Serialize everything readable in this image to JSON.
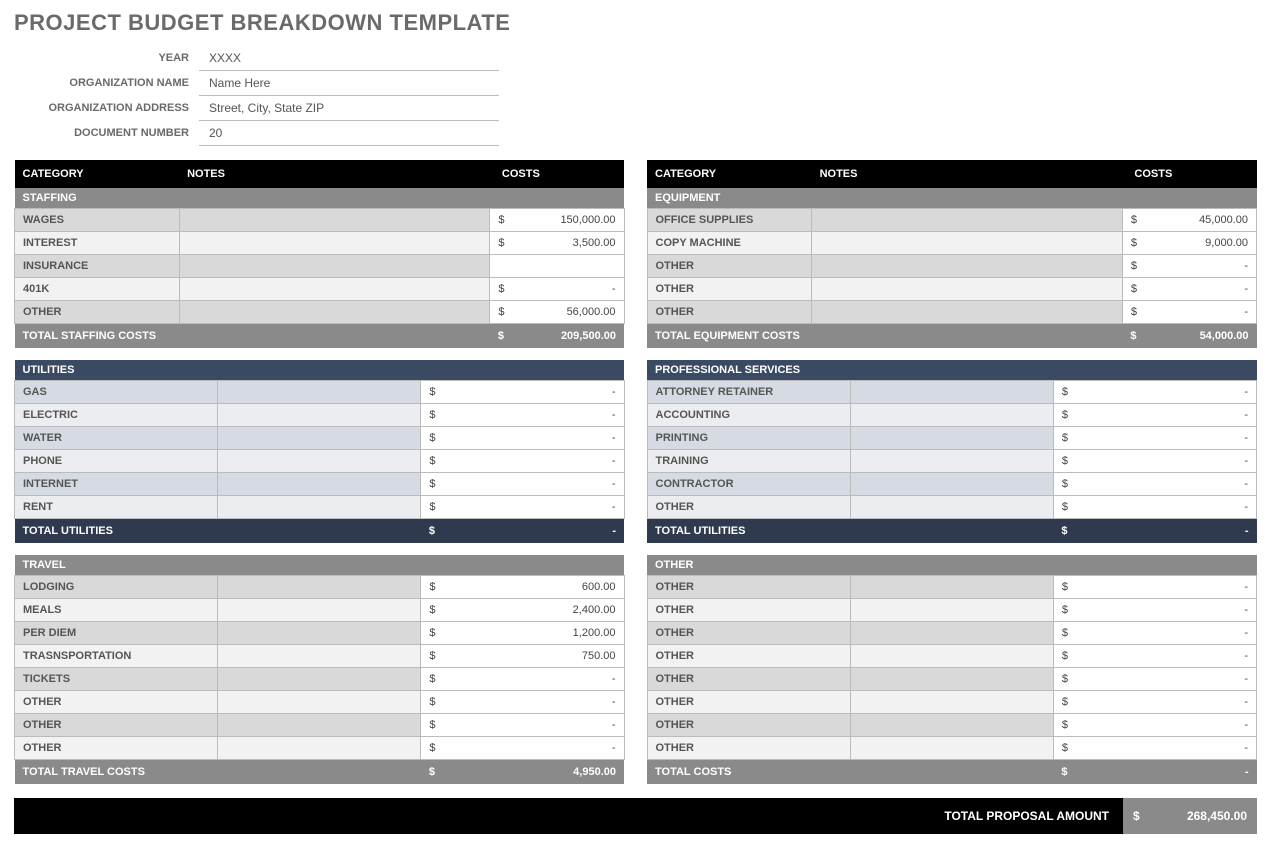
{
  "title": "PROJECT BUDGET BREAKDOWN TEMPLATE",
  "info": {
    "fields": [
      {
        "label": "YEAR",
        "value": "XXXX"
      },
      {
        "label": "ORGANIZATION NAME",
        "value": "Name Here"
      },
      {
        "label": "ORGANIZATION ADDRESS",
        "value": "Street, City, State ZIP"
      },
      {
        "label": "DOCUMENT NUMBER",
        "value": "20"
      }
    ]
  },
  "headers": {
    "category": "CATEGORY",
    "notes": "NOTES",
    "costs": "COSTS"
  },
  "left": [
    {
      "style": "gray",
      "title": "STAFFING",
      "rows": [
        {
          "cat": "WAGES",
          "notes": "",
          "sym": "$",
          "cost": "150,000.00"
        },
        {
          "cat": "INTEREST",
          "notes": "",
          "sym": "$",
          "cost": "3,500.00"
        },
        {
          "cat": "INSURANCE",
          "notes": "",
          "sym": "",
          "cost": ""
        },
        {
          "cat": "401K",
          "notes": "",
          "sym": "$",
          "cost": "-"
        },
        {
          "cat": "OTHER",
          "notes": "",
          "sym": "$",
          "cost": "56,000.00"
        }
      ],
      "total": {
        "label": "TOTAL STAFFING COSTS",
        "sym": "$",
        "cost": "209,500.00"
      }
    },
    {
      "style": "navy",
      "title": "UTILITIES",
      "rows": [
        {
          "cat": "GAS",
          "notes": "",
          "sym": "$",
          "cost": "-"
        },
        {
          "cat": "ELECTRIC",
          "notes": "",
          "sym": "$",
          "cost": "-"
        },
        {
          "cat": "WATER",
          "notes": "",
          "sym": "$",
          "cost": "-"
        },
        {
          "cat": "PHONE",
          "notes": "",
          "sym": "$",
          "cost": "-"
        },
        {
          "cat": "INTERNET",
          "notes": "",
          "sym": "$",
          "cost": "-"
        },
        {
          "cat": "RENT",
          "notes": "",
          "sym": "$",
          "cost": "-"
        }
      ],
      "total": {
        "label": "TOTAL UTILITIES",
        "sym": "$",
        "cost": "-"
      }
    },
    {
      "style": "gray",
      "title": "TRAVEL",
      "rows": [
        {
          "cat": "LODGING",
          "notes": "",
          "sym": "$",
          "cost": "600.00"
        },
        {
          "cat": "MEALS",
          "notes": "",
          "sym": "$",
          "cost": "2,400.00"
        },
        {
          "cat": "PER DIEM",
          "notes": "",
          "sym": "$",
          "cost": "1,200.00"
        },
        {
          "cat": "TRASNSPORTATION",
          "notes": "",
          "sym": "$",
          "cost": "750.00"
        },
        {
          "cat": "TICKETS",
          "notes": "",
          "sym": "$",
          "cost": "-"
        },
        {
          "cat": "OTHER",
          "notes": "",
          "sym": "$",
          "cost": "-"
        },
        {
          "cat": "OTHER",
          "notes": "",
          "sym": "$",
          "cost": "-"
        },
        {
          "cat": "OTHER",
          "notes": "",
          "sym": "$",
          "cost": "-"
        }
      ],
      "total": {
        "label": "TOTAL TRAVEL COSTS",
        "sym": "$",
        "cost": "4,950.00"
      }
    }
  ],
  "right": [
    {
      "style": "gray",
      "title": "EQUIPMENT",
      "rows": [
        {
          "cat": "OFFICE SUPPLIES",
          "notes": "",
          "sym": "$",
          "cost": "45,000.00"
        },
        {
          "cat": "COPY MACHINE",
          "notes": "",
          "sym": "$",
          "cost": "9,000.00"
        },
        {
          "cat": "OTHER",
          "notes": "",
          "sym": "$",
          "cost": "-"
        },
        {
          "cat": "OTHER",
          "notes": "",
          "sym": "$",
          "cost": "-"
        },
        {
          "cat": "OTHER",
          "notes": "",
          "sym": "$",
          "cost": "-"
        }
      ],
      "total": {
        "label": "TOTAL EQUIPMENT COSTS",
        "sym": "$",
        "cost": "54,000.00"
      }
    },
    {
      "style": "navy",
      "title": "PROFESSIONAL SERVICES",
      "rows": [
        {
          "cat": "ATTORNEY RETAINER",
          "notes": "",
          "sym": "$",
          "cost": "-"
        },
        {
          "cat": "ACCOUNTING",
          "notes": "",
          "sym": "$",
          "cost": "-"
        },
        {
          "cat": "PRINTING",
          "notes": "",
          "sym": "$",
          "cost": "-"
        },
        {
          "cat": "TRAINING",
          "notes": "",
          "sym": "$",
          "cost": "-"
        },
        {
          "cat": "CONTRACTOR",
          "notes": "",
          "sym": "$",
          "cost": "-"
        },
        {
          "cat": "OTHER",
          "notes": "",
          "sym": "$",
          "cost": "-"
        }
      ],
      "total": {
        "label": "TOTAL UTILITIES",
        "sym": "$",
        "cost": "-"
      }
    },
    {
      "style": "gray",
      "title": "OTHER",
      "rows": [
        {
          "cat": "OTHER",
          "notes": "",
          "sym": "$",
          "cost": "-"
        },
        {
          "cat": "OTHER",
          "notes": "",
          "sym": "$",
          "cost": "-"
        },
        {
          "cat": "OTHER",
          "notes": "",
          "sym": "$",
          "cost": "-"
        },
        {
          "cat": "OTHER",
          "notes": "",
          "sym": "$",
          "cost": "-"
        },
        {
          "cat": "OTHER",
          "notes": "",
          "sym": "$",
          "cost": "-"
        },
        {
          "cat": "OTHER",
          "notes": "",
          "sym": "$",
          "cost": "-"
        },
        {
          "cat": "OTHER",
          "notes": "",
          "sym": "$",
          "cost": "-"
        },
        {
          "cat": "OTHER",
          "notes": "",
          "sym": "$",
          "cost": "-"
        }
      ],
      "total": {
        "label": "TOTAL COSTS",
        "sym": "$",
        "cost": "-"
      }
    }
  ],
  "footer": {
    "label": "TOTAL PROPOSAL AMOUNT",
    "sym": "$",
    "cost": "268,450.00"
  }
}
